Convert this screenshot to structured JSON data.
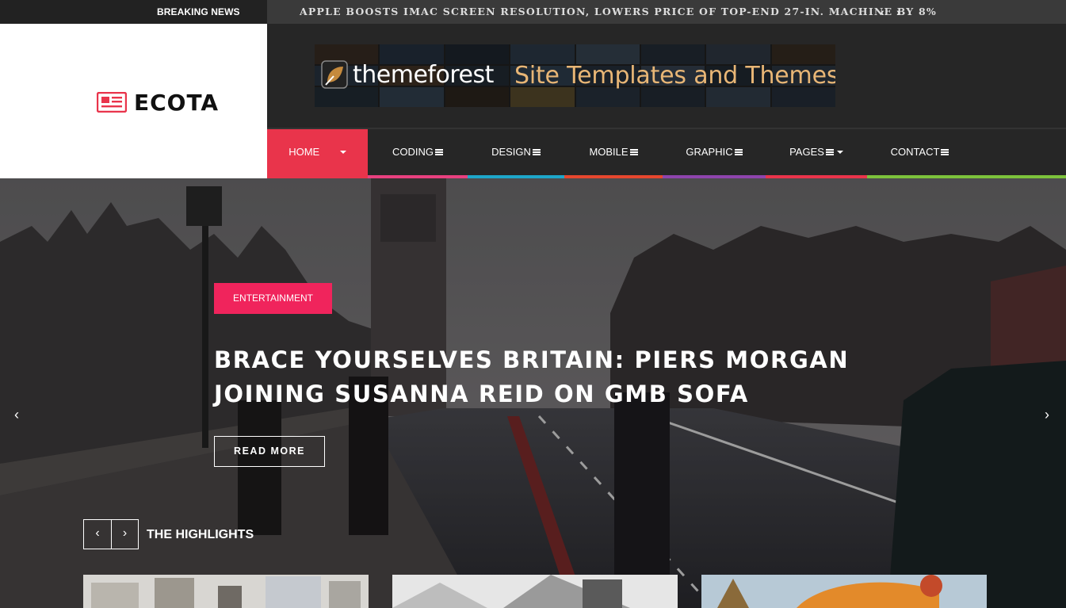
{
  "breaking": {
    "label": "BREAKING NEWS",
    "headline": "APPLE BOOSTS IMAC SCREEN RESOLUTION, LOWERS PRICE OF TOP-END 27-IN. MACHINE BY 8%",
    "prev": "‹",
    "next": "›"
  },
  "logo": {
    "text": "ECOTA",
    "icon": "newspaper-icon",
    "color": "#e9344b"
  },
  "ad": {
    "brand": "themeforest",
    "slogan": "Site Templates and Themes",
    "icon": "themeforest-leaf-icon"
  },
  "nav": {
    "items": [
      {
        "label": "HOME",
        "active": true,
        "caret": true,
        "color": "#e9344b"
      },
      {
        "label": "CODING",
        "hamburger": true,
        "color": "#e8407f"
      },
      {
        "label": "DESIGN",
        "hamburger": true,
        "color": "#1ea6c9"
      },
      {
        "label": "MOBILE",
        "hamburger": true,
        "color": "#e6472e"
      },
      {
        "label": "GRAPHIC",
        "hamburger": true,
        "color": "#8e44ad"
      },
      {
        "label": "PAGES",
        "hamburger": true,
        "caret": true,
        "color": "#e9344b"
      },
      {
        "label": "CONTACT",
        "hamburger": true,
        "color": "#7cc23b"
      }
    ]
  },
  "hero": {
    "category": "ENTERTAINMENT",
    "title": "BRACE YOURSELVES BRITAIN: PIERS MORGAN JOINING SUSANNA REID ON GMB SOFA",
    "read_more": "READ MORE",
    "prev": "‹",
    "next": "›",
    "badge_color": "#f0245c"
  },
  "highlights": {
    "title": "THE HIGHLIGHTS",
    "prev": "‹",
    "next": "›"
  }
}
